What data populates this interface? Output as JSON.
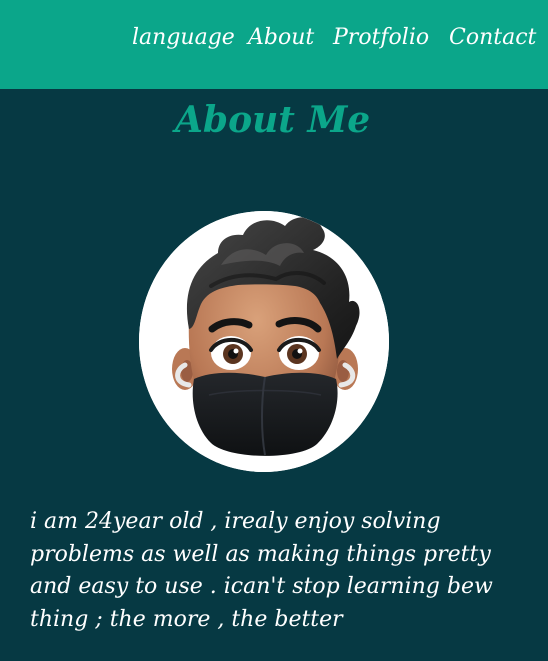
{
  "nav": {
    "items": [
      {
        "label": "language"
      },
      {
        "label": "About"
      },
      {
        "label": "Protfolio"
      },
      {
        "label": "Contact"
      }
    ]
  },
  "main": {
    "title": "About Me",
    "avatar_icon": "memoji-avatar-with-black-face-mask",
    "bio": "i am 24year old , irealy enjoy solving problems as well as making things pretty and easy to use . ican't stop learning bew thing ; the more , the better"
  },
  "colors": {
    "background": "#063943",
    "navbar": "#0ba68a",
    "accent": "#0ba68a",
    "text": "#ffffff"
  }
}
